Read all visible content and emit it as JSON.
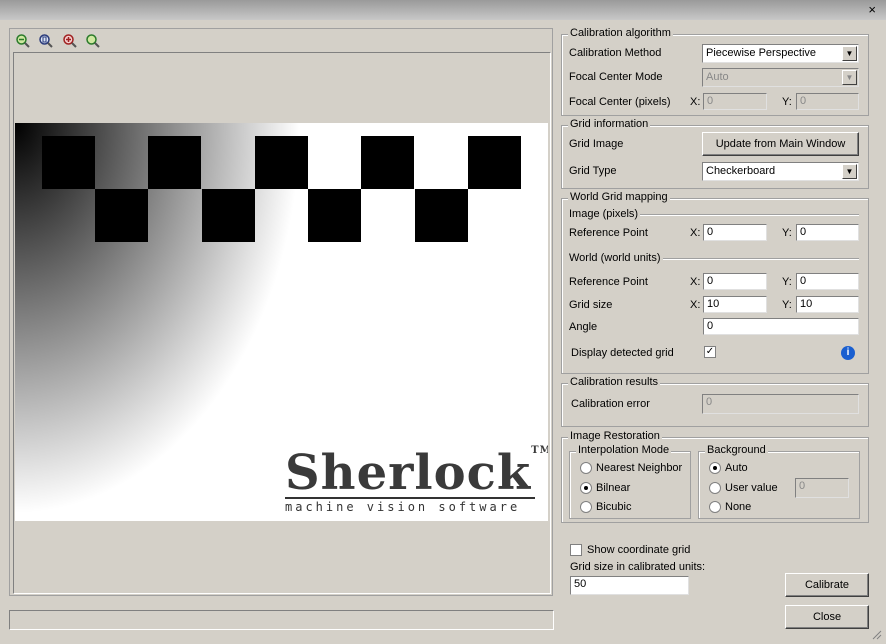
{
  "window": {
    "close_glyph": "×"
  },
  "toolbar": {
    "icons": [
      "zoom-out-icon",
      "zoom-fit-icon",
      "zoom-in-icon",
      "zoom-reset-icon"
    ]
  },
  "logo": {
    "name": "Sherlock",
    "tm": "TM",
    "tagline": "machine vision software"
  },
  "calibration_algorithm": {
    "title": "Calibration algorithm",
    "method_label": "Calibration Method",
    "method_value": "Piecewise Perspective",
    "focal_mode_label": "Focal Center Mode",
    "focal_mode_value": "Auto",
    "focal_center_label": "Focal Center (pixels)",
    "x_label": "X:",
    "x_value": "0",
    "y_label": "Y:",
    "y_value": "0"
  },
  "grid_information": {
    "title": "Grid information",
    "image_label": "Grid Image",
    "update_button": "Update from Main Window",
    "type_label": "Grid Type",
    "type_value": "Checkerboard"
  },
  "world_grid": {
    "title": "World Grid mapping",
    "image_section": "Image (pixels)",
    "image_ref_label": "Reference Point",
    "image_ref_x": "0",
    "image_ref_y": "0",
    "world_section": "World (world units)",
    "world_ref_label": "Reference Point",
    "world_ref_x": "0",
    "world_ref_y": "0",
    "grid_size_label": "Grid size",
    "grid_size_x": "10",
    "grid_size_y": "10",
    "angle_label": "Angle",
    "angle_value": "0",
    "display_detected_label": "Display detected grid",
    "display_detected_checked": "✓",
    "x_label": "X:",
    "y_label": "Y:",
    "info_glyph": "i"
  },
  "calibration_results": {
    "title": "Calibration results",
    "error_label": "Calibration error",
    "error_value": "0"
  },
  "image_restoration": {
    "title": "Image Restoration",
    "interp_title": "Interpolation Mode",
    "nearest": "Nearest Neighbor",
    "bilinear": "Bilnear",
    "bicubic": "Bicubic",
    "background_title": "Background",
    "auto": "Auto",
    "user_value": "User value",
    "user_value_field": "0",
    "none": "None"
  },
  "bottom": {
    "show_grid_label": "Show coordinate grid",
    "grid_size_units_label": "Grid size in calibrated units:",
    "grid_size_units_value": "50",
    "calibrate_button": "Calibrate",
    "close_button": "Close"
  }
}
